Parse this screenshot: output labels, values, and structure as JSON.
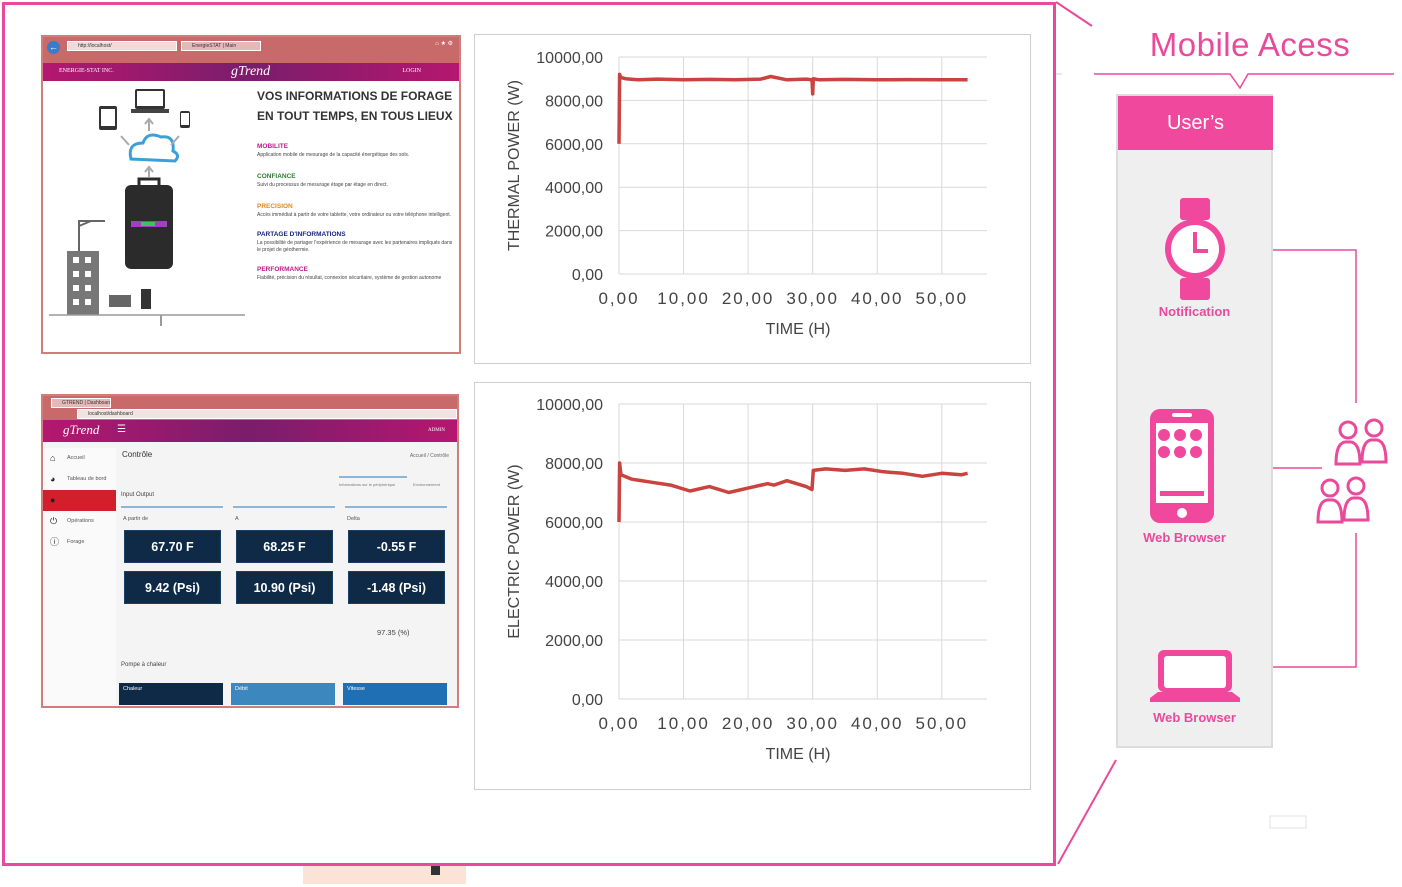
{
  "mobile_access": {
    "title": "Mobile Acess",
    "panel_header": "User’s",
    "notification_label": "Notification",
    "web_browser_mobile_label": "Web Browser",
    "web_browser_laptop_label": "Web Browser",
    "accent_color": "#e94a9b"
  },
  "website_screenshot": {
    "address": "http://localhost/",
    "tab_title": "EnergieSTAT | Main",
    "company": "ENERGIE-STAT INC.",
    "logo": "gTrend",
    "login": "LOGIN",
    "headline_1": "VOS INFORMATIONS DE FORAGE",
    "headline_2": "EN TOUT TEMPS, EN TOUS LIEUX",
    "features": [
      {
        "title": "MOBILITE",
        "color": "#c2188a",
        "desc": "Application mobile de mesurage de la capacité énergétique des sols."
      },
      {
        "title": "CONFIANCE",
        "color": "#2e7d32",
        "desc": "Suivi du processus de mesurage étage par étage en direct."
      },
      {
        "title": "PRECISION",
        "color": "#e08a1a",
        "desc": "Accès immédiat à partir de votre tablette, votre ordinateur ou votre téléphone intelligent."
      },
      {
        "title": "PARTAGE D'INFORMATIONS",
        "color": "#1a237e",
        "desc": "La possibilité de partager l'expérience de mesurage avec les partenaires impliqués dans le projet de géothermie."
      },
      {
        "title": "PERFORMANCE",
        "color": "#c2188a",
        "desc": "Fiabilité, précision du résultat, connexion sécuritaire, système de gestion autonome"
      }
    ]
  },
  "dashboard_screenshot": {
    "tab_title": "GTREND | Dashboard",
    "address": "localhost/dashboard",
    "logo": "gTrend",
    "user": "ADMIN",
    "sidebar": [
      "Accueil",
      "Tableau de bord",
      "",
      "Opérations",
      "Forage"
    ],
    "page_title": "Contrôle",
    "breadcrumb": "Accueil / Contrôle",
    "tabs": [
      "Informations sur le périphérique",
      "Environnement"
    ],
    "section": "Input Output",
    "columns": [
      "A partir de",
      "A",
      "Delta"
    ],
    "row1": [
      "67.70 F",
      "68.25 F",
      "-0.55 F"
    ],
    "row2": [
      "9.42 (Psi)",
      "10.90 (Psi)",
      "-1.48 (Psi)"
    ],
    "percent": "97.35 (%)",
    "section2": "Pompe à chaleur",
    "bottom_tiles": [
      "Chaleur",
      "Débit",
      "Vitesse"
    ]
  },
  "chart_data": [
    {
      "type": "line",
      "title": "",
      "xlabel": "TIME (H)",
      "ylabel": "THERMAL POWER (W)",
      "xlim": [
        0,
        57
      ],
      "ylim": [
        0,
        10000
      ],
      "xticks": [
        "0,00",
        "10,00",
        "20,00",
        "30,00",
        "40,00",
        "50,00"
      ],
      "yticks": [
        "0,00",
        "2000,00",
        "4000,00",
        "6000,00",
        "8000,00",
        "10000,00"
      ],
      "grid": true,
      "color": "#c9433f",
      "series": [
        {
          "x": [
            0,
            0.1,
            0.3,
            1,
            3,
            6,
            10,
            14,
            18,
            22,
            23.5,
            26,
            29,
            29.9,
            30,
            30.1,
            31,
            35,
            40,
            45,
            50,
            54
          ],
          "y": [
            6000,
            9200,
            9050,
            9000,
            8950,
            8980,
            8950,
            8970,
            8950,
            8980,
            9100,
            8950,
            8980,
            8950,
            8300,
            9000,
            8950,
            8970,
            8950,
            8960,
            8950,
            8950
          ]
        }
      ]
    },
    {
      "type": "line",
      "title": "",
      "xlabel": "TIME (H)",
      "ylabel": "ELECTRIC POWER (W)",
      "xlim": [
        0,
        57
      ],
      "ylim": [
        0,
        10000
      ],
      "xticks": [
        "0,00",
        "10,00",
        "20,00",
        "30,00",
        "40,00",
        "50,00"
      ],
      "yticks": [
        "0,00",
        "2000,00",
        "4000,00",
        "6000,00",
        "8000,00",
        "10000,00"
      ],
      "grid": true,
      "color": "#c9433f",
      "series": [
        {
          "x": [
            0,
            0.1,
            0.3,
            2,
            5,
            8,
            11,
            14,
            17,
            20,
            23,
            24,
            26,
            29,
            29.9,
            30.1,
            32,
            35,
            38,
            41,
            44,
            47,
            50,
            53,
            54
          ],
          "y": [
            6000,
            8000,
            7600,
            7450,
            7350,
            7250,
            7050,
            7200,
            7000,
            7150,
            7300,
            7250,
            7400,
            7200,
            7100,
            7750,
            7800,
            7750,
            7800,
            7700,
            7650,
            7550,
            7650,
            7600,
            7650
          ]
        }
      ]
    }
  ]
}
